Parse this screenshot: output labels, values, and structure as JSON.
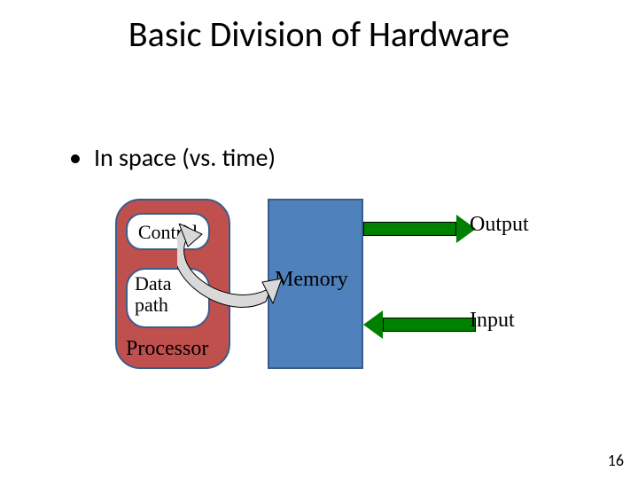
{
  "title": "Basic Division of Hardware",
  "bullet": "In space (vs. time)",
  "labels": {
    "control": "Control",
    "datapath": "Data path",
    "processor": "Processor",
    "memory": "Memory",
    "output": "Output",
    "input": "Input"
  },
  "page": "16"
}
